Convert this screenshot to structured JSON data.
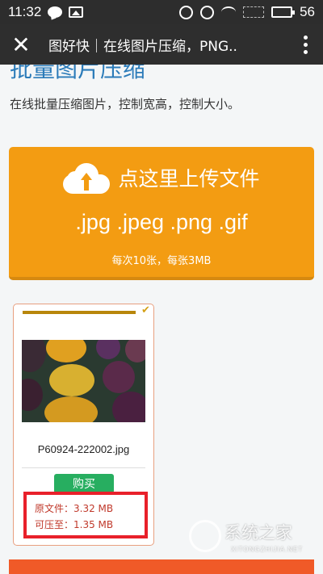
{
  "status_bar": {
    "time": "11:32",
    "battery": "56"
  },
  "title_bar": {
    "close_glyph": "✕",
    "title": "图好快｜在线图片压缩，PNG.."
  },
  "page": {
    "heading_partial": "批量图片压缩",
    "subtitle": "在线批量压缩图片，控制宽高，控制大小。"
  },
  "upload": {
    "title": "点这里上传文件",
    "formats": ".jpg .jpeg .png .gif",
    "limit": "每次10张，每张3MB",
    "color": "#f39c12"
  },
  "file_card": {
    "file_name": "P60924-222002.jpg",
    "buy_label": "购买",
    "original_size": "原文件：3.32 MB",
    "compressed_size": "可压至：1.35 MB",
    "progress_fraction": 1.0
  },
  "watermark": {
    "brand": "系统之家",
    "domain": "XITONGZHIJIA.NET"
  }
}
